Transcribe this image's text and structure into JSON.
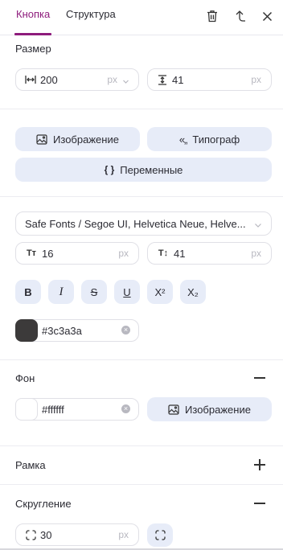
{
  "tabs": {
    "active": "Кнопка",
    "second": "Структура"
  },
  "size": {
    "title": "Размер",
    "width_value": "200",
    "width_unit": "px",
    "height_value": "41",
    "height_unit": "px"
  },
  "actions": {
    "image_label": "Изображение",
    "typograph_label": "Типограф",
    "variables_label": "Переменные"
  },
  "typography": {
    "font_value": "Safe Fonts / Segoe UI, Helvetica Neue, Helve...",
    "font_size": "16",
    "font_size_unit": "px",
    "line_height": "41",
    "line_height_unit": "px",
    "format_buttons": [
      "B",
      "I",
      "S",
      "U",
      "X²",
      "X₂"
    ],
    "color_value": "#3c3a3a",
    "color_swatch": "#3c3a3a"
  },
  "background": {
    "title": "Фон",
    "color_value": "#ffffff",
    "color_swatch": "#ffffff",
    "image_label": "Изображение"
  },
  "border": {
    "title": "Рамка"
  },
  "rounding": {
    "title": "Скругление",
    "value": "30",
    "unit": "px"
  },
  "colors": {
    "accent": "#8e1c7c",
    "pill_bg": "#e7ecf8",
    "field_border": "#e0e0e6"
  }
}
